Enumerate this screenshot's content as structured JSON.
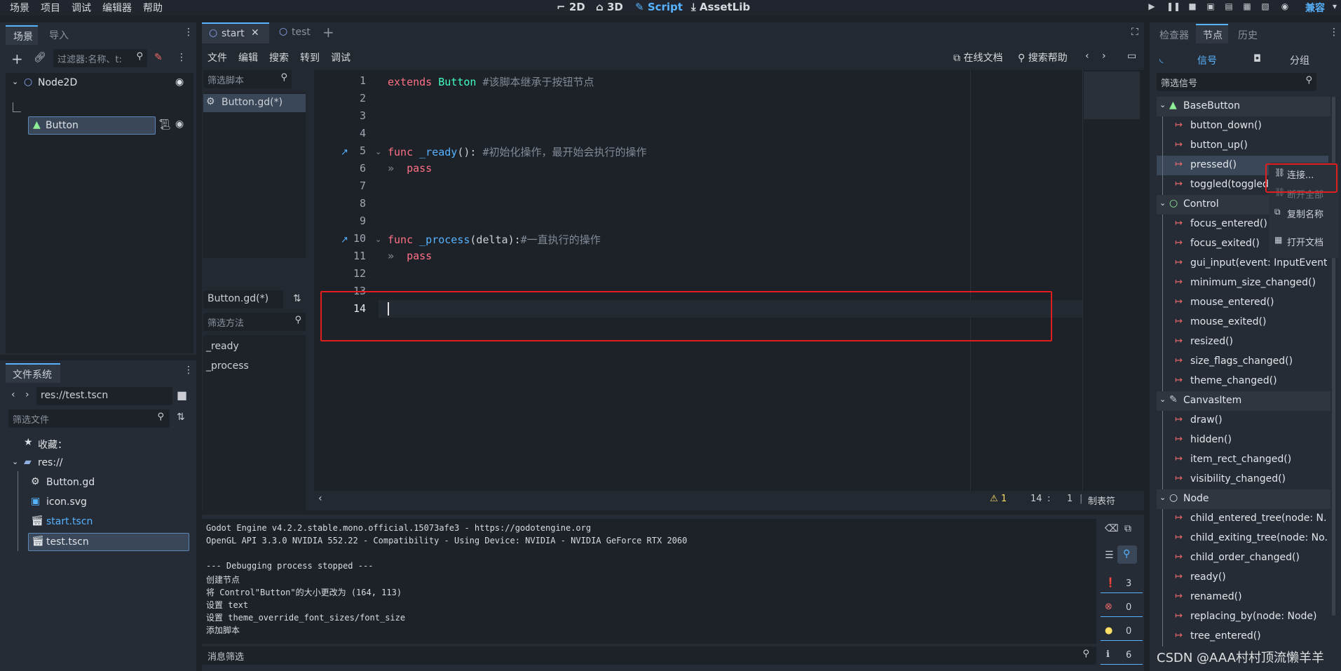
{
  "menu": [
    "场景",
    "项目",
    "调试",
    "编辑器",
    "帮助"
  ],
  "modes": {
    "m2d": "2D",
    "m3d": "3D",
    "script": "Script",
    "assetlib": "AssetLib"
  },
  "renderer": "兼容",
  "scene_dock": {
    "tabs": [
      "场景",
      "导入"
    ],
    "filter_placeholder": "过滤器:名称、t:",
    "nodes": [
      {
        "label": "Node2D"
      },
      {
        "label": "Button"
      }
    ]
  },
  "filesystem": {
    "title": "文件系统",
    "path": "res://test.tscn",
    "filter_placeholder": "筛选文件",
    "favorites": "收藏：",
    "root": "res://",
    "files": [
      "Button.gd",
      "icon.svg",
      "start.tscn",
      "test.tscn"
    ]
  },
  "script_editor": {
    "tabs": [
      "start",
      "test"
    ],
    "menu": [
      "文件",
      "编辑",
      "搜索",
      "转到",
      "调试"
    ],
    "online_docs": "在线文档",
    "search_help": "搜索帮助",
    "script_filter_placeholder": "筛选脚本",
    "scripts": [
      "Button.gd(*)"
    ],
    "current_script": "Button.gd(*)",
    "method_filter_placeholder": "筛选方法",
    "methods": [
      "_ready",
      "_process"
    ],
    "status": {
      "warnings": "1",
      "line": "14",
      "sep": ":",
      "col": "1",
      "indent": "制表符"
    }
  },
  "code": {
    "line_numbers": [
      "1",
      "2",
      "3",
      "4",
      "5",
      "6",
      "7",
      "8",
      "9",
      "10",
      "11",
      "12",
      "13",
      "14"
    ],
    "l1": {
      "kw": "extends",
      "type": "Button",
      "comment": "#该脚本继承于按钮节点"
    },
    "l5": {
      "kw": "func",
      "name": "_ready",
      "paren": "():",
      "comment": "#初始化操作，最开始会执行的操作"
    },
    "l6": {
      "kw": "pass"
    },
    "l10": {
      "kw": "func",
      "name": "_process",
      "args": "(delta):",
      "comment": "#一直执行的操作"
    },
    "l11": {
      "kw": "pass"
    }
  },
  "console": {
    "lines": [
      "Godot Engine v4.2.2.stable.mono.official.15073afe3 - https://godotengine.org",
      "OpenGL API 3.3.0 NVIDIA 552.22 - Compatibility - Using Device: NVIDIA - NVIDIA GeForce RTX 2060",
      "",
      "--- Debugging process stopped ---",
      "创建节点",
      "将 Control\"Button\"的大小更改为 (164, 113)",
      "设置 text",
      "设置 theme_override_font_sizes/font_size",
      "添加脚本"
    ],
    "filter_placeholder": "消息筛选",
    "counts": {
      "messages": "3",
      "errors": "0",
      "warnings": "0",
      "info": "6"
    }
  },
  "right_dock": {
    "tabs": [
      "检查器",
      "节点",
      "历史"
    ],
    "subtabs": {
      "signals": "信号",
      "groups": "分组"
    },
    "filter_placeholder": "筛选信号",
    "classes": [
      {
        "name": "BaseButton",
        "signals": [
          "button_down()",
          "button_up()",
          "pressed()",
          "toggled(toggled_on: bool)"
        ]
      },
      {
        "name": "Control",
        "signals": [
          "focus_entered()",
          "focus_exited()",
          "gui_input(event: InputEvent)",
          "minimum_size_changed()",
          "mouse_entered()",
          "mouse_exited()",
          "resized()",
          "size_flags_changed()",
          "theme_changed()"
        ]
      },
      {
        "name": "CanvasItem",
        "signals": [
          "draw()",
          "hidden()",
          "item_rect_changed()",
          "visibility_changed()"
        ]
      },
      {
        "name": "Node",
        "signals": [
          "child_entered_tree(node: N...",
          "child_exiting_tree(node: No...",
          "child_order_changed()",
          "ready()",
          "renamed()",
          "replacing_by(node: Node)",
          "tree_entered()"
        ]
      }
    ]
  },
  "context_menu": [
    "连接...",
    "断开全部",
    "复制名称",
    "打开文档"
  ],
  "watermark": "CSDN @AAA村村顶流懒羊羊"
}
